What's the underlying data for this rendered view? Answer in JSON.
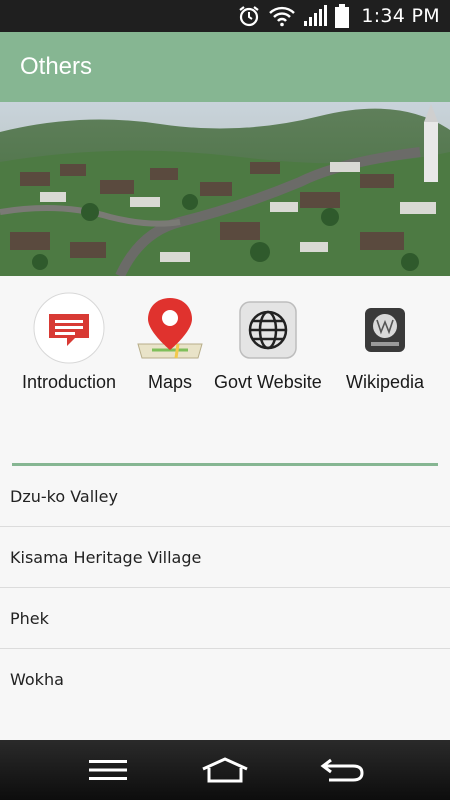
{
  "status_bar": {
    "time": "1:34 PM",
    "icons": [
      "alarm-icon",
      "wifi-icon",
      "signal-icon",
      "battery-icon"
    ]
  },
  "app_bar": {
    "title": "Others",
    "color": "#86b692"
  },
  "hero": {
    "image": "aerial-village-photo"
  },
  "shortcuts": [
    {
      "label": "Introduction",
      "icon": "speech-bubble-icon"
    },
    {
      "label": "Maps",
      "icon": "map-pin-icon"
    },
    {
      "label": "Govt Website",
      "icon": "globe-icon"
    },
    {
      "label": "Wikipedia",
      "icon": "wikipedia-icon"
    }
  ],
  "places": [
    {
      "label": "Dzu-ko Valley"
    },
    {
      "label": "Kisama Heritage Village"
    },
    {
      "label": "Phek"
    },
    {
      "label": "Wokha"
    }
  ],
  "nav_bar": {
    "buttons": [
      "menu-icon",
      "home-icon",
      "back-icon"
    ]
  }
}
